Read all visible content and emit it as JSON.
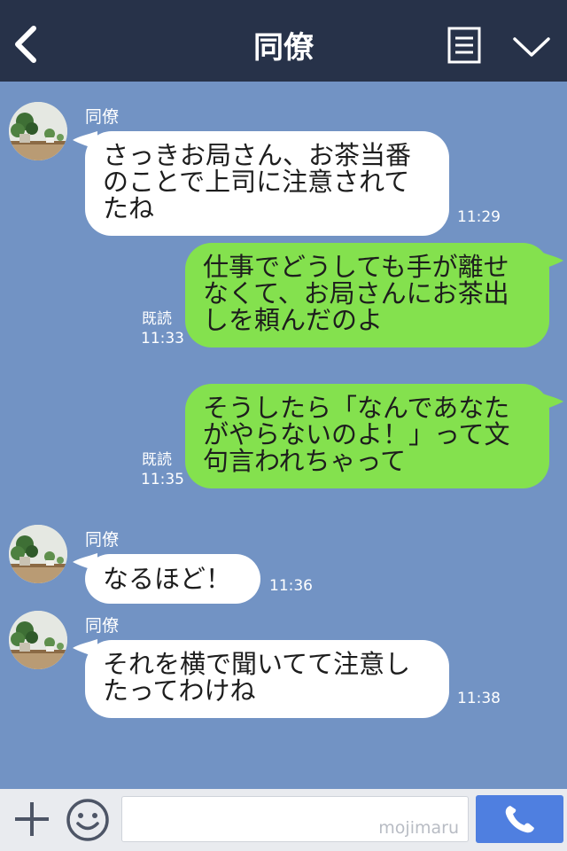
{
  "header": {
    "title": "同僚"
  },
  "messages": [
    {
      "sender": "同僚",
      "text": "さっきお局さん、お茶当番\nのことで上司に注意されて\nたね",
      "time": "11:29"
    },
    {
      "read": "既読",
      "text": "仕事でどうしても手が離せ\nなくて、お局さんにお茶出\nしを頼んだのよ",
      "time": "11:33"
    },
    {
      "read": "既読",
      "text": "そうしたら「なんであなた\nがやらないのよ！」って文\n句言われちゃって",
      "time": "11:35"
    },
    {
      "sender": "同僚",
      "text": "なるほど！",
      "time": "11:36"
    },
    {
      "sender": "同僚",
      "text": "それを横で聞いてて注意し\nたってわけね",
      "time": "11:38"
    }
  ],
  "footer": {
    "input_text": "mojimaru"
  },
  "colors": {
    "header_bg": "#273249",
    "chat_bg": "#7293c4",
    "incoming_bubble": "#ffffff",
    "outgoing_bubble": "#84e14e",
    "call_button": "#4f7fe0"
  },
  "icons": [
    "back-icon",
    "menu-icon",
    "chevron-down-icon",
    "plus-icon",
    "smile-icon",
    "phone-icon"
  ]
}
